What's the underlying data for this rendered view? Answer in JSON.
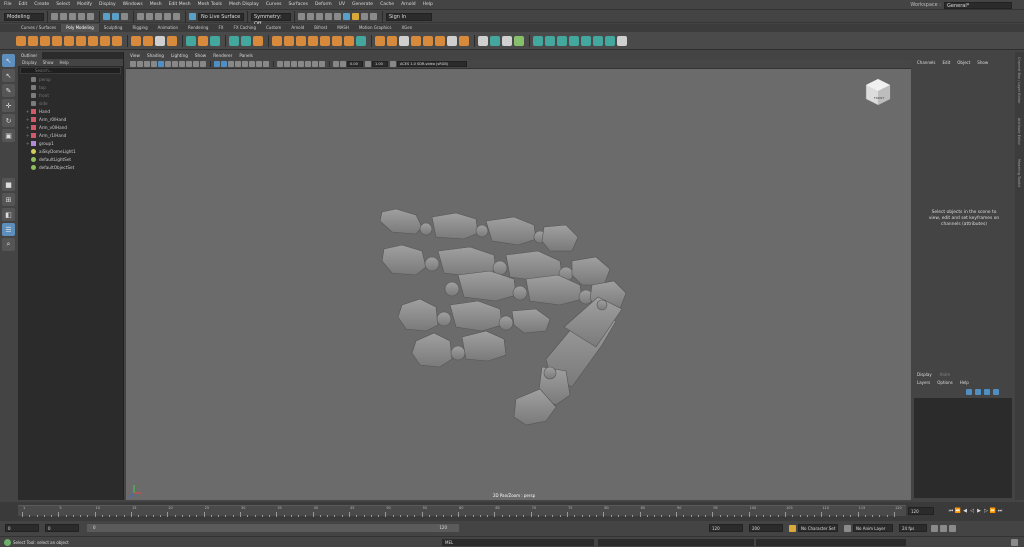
{
  "menubar": {
    "items": [
      "File",
      "Edit",
      "Create",
      "Select",
      "Modify",
      "Display",
      "Windows",
      "Mesh",
      "Edit Mesh",
      "Mesh Tools",
      "Mesh Display",
      "Curves",
      "Surfaces",
      "Deform",
      "UV",
      "Generate",
      "Cache",
      "Arnold",
      "Help"
    ],
    "workspace_label": "Workspace :",
    "workspace_value": "General*"
  },
  "statusline": {
    "mode": "Modeling",
    "live_surface": "No Live Surface",
    "symmetry": "Symmetry: Off",
    "sign_in": "Sign In"
  },
  "shelf": {
    "tabs": [
      "Curves / Surfaces",
      "Poly Modeling",
      "Sculpting",
      "Rigging",
      "Animation",
      "Rendering",
      "FX",
      "FX Caching",
      "Custom",
      "Arnold",
      "Bifrost",
      "MASH",
      "Motion Graphics",
      "XGen"
    ],
    "active_tab": 1
  },
  "outliner": {
    "tab_label": "Outliner",
    "menu": [
      "Display",
      "Show",
      "Help"
    ],
    "search_placeholder": "Search...",
    "items": [
      {
        "label": "persp",
        "type": "cam",
        "dim": true
      },
      {
        "label": "top",
        "type": "cam",
        "dim": true
      },
      {
        "label": "front",
        "type": "cam",
        "dim": true
      },
      {
        "label": "side",
        "type": "cam",
        "dim": true
      },
      {
        "label": "Hand",
        "type": "mesh",
        "expand": "+"
      },
      {
        "label": "Arm_r0lHand",
        "type": "mesh",
        "expand": "+"
      },
      {
        "label": "Arm_v0lHand",
        "type": "mesh",
        "expand": "+"
      },
      {
        "label": "Arm_r1lHand",
        "type": "mesh",
        "expand": "+"
      },
      {
        "label": "group1",
        "type": "grp",
        "expand": "+"
      },
      {
        "label": "aiSkyDomeLight1",
        "type": "light",
        "expand": ""
      },
      {
        "label": "defaultLightSet",
        "type": "set",
        "expand": ""
      },
      {
        "label": "defaultObjectSet",
        "type": "set",
        "expand": ""
      }
    ]
  },
  "viewport": {
    "menu": [
      "View",
      "Shading",
      "Lighting",
      "Show",
      "Renderer",
      "Panels"
    ],
    "exposure": "0.00",
    "gamma": "1.00",
    "color_space": "ACES 1.0 SDR-video (sRGB)",
    "label": "2D Pan/Zoom : persp",
    "viewcube_label": "FRONT"
  },
  "channelbox": {
    "menu": [
      "Channels",
      "Edit",
      "Object",
      "Show"
    ],
    "message": "Select objects in the scene to view, edit and set keyframes on channels (attributes)",
    "layer_tabs": [
      "Display",
      "Anim"
    ],
    "layer_menu": [
      "Layers",
      "Options",
      "Help"
    ],
    "side_tabs": [
      "Channel Box / Layer Editor",
      "Attribute Editor",
      "Modeling Toolkit"
    ]
  },
  "timeslider": {
    "labels": [
      "1",
      "5",
      "10",
      "15",
      "20",
      "25",
      "30",
      "35",
      "40",
      "45",
      "50",
      "55",
      "60",
      "65",
      "70",
      "75",
      "80",
      "85",
      "90",
      "95",
      "100",
      "105",
      "110",
      "115",
      "120"
    ],
    "current_frame": "120"
  },
  "rangeslider": {
    "start": "0",
    "inner_start": "0",
    "range_label_start": "0",
    "range_label_end": "120",
    "end": "120",
    "outer_end": "200",
    "character_set": "No Character Set",
    "anim_layer": "No Anim Layer",
    "fps": "24 fps"
  },
  "helpline": {
    "message": "Select Tool: select an object",
    "mel": "MEL"
  },
  "colors": {
    "accent_blue": "#5c8fbd",
    "viewport_bg": "#6b6b6b",
    "shelf_orange": "#d88a3c",
    "shelf_teal": "#44a79d"
  }
}
